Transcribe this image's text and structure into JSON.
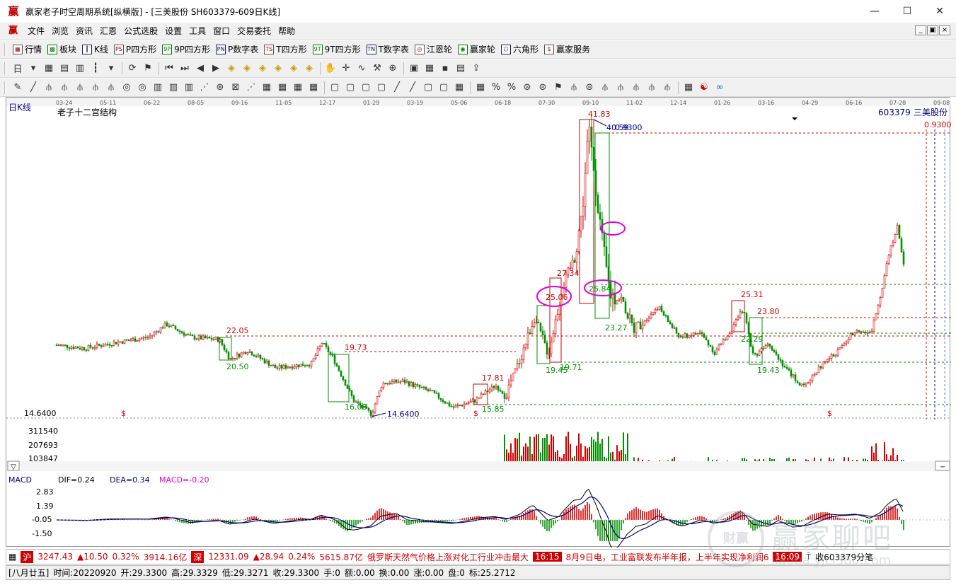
{
  "window": {
    "title": "赢家老子时空周期系统[纵横版] - [三美股份   SH603379-609日K线]",
    "logo_glyph": "赢",
    "controls": {
      "minimize": "—",
      "maximize": "☐",
      "close": "✕"
    }
  },
  "menu": {
    "logo_glyph": "赢",
    "items": [
      "文件",
      "浏览",
      "资讯",
      "汇恩",
      "公式选股",
      "设置",
      "工具",
      "窗口",
      "交易委托",
      "帮助"
    ],
    "mdi": [
      "_",
      "▣",
      "×"
    ]
  },
  "toolbar1": {
    "items": [
      {
        "icon": "market-icon",
        "glyph": "▦",
        "label": "行情"
      },
      {
        "icon": "sector-icon",
        "glyph": "▩",
        "label": "板块"
      },
      {
        "icon": "kline-icon",
        "glyph": "┃",
        "label": "K线"
      },
      {
        "icon": "ps-icon",
        "glyph": "PS",
        "label": "P四方形"
      },
      {
        "icon": "9p-icon",
        "glyph": "9P",
        "label": "9P四方形"
      },
      {
        "icon": "pn-icon",
        "glyph": "PN",
        "label": "P数字表"
      },
      {
        "icon": "ts-icon",
        "glyph": "TS",
        "label": "T四方形"
      },
      {
        "icon": "9t-icon",
        "glyph": "9T",
        "label": "9T四方形"
      },
      {
        "icon": "tn-icon",
        "glyph": "TN",
        "label": "T数字表"
      },
      {
        "icon": "jiangen-wheel-icon",
        "glyph": "◎",
        "label": "江恩轮"
      },
      {
        "icon": "winner-wheel-icon",
        "glyph": "◉",
        "label": "赢家轮"
      },
      {
        "icon": "hexagon-icon",
        "glyph": "⬡",
        "label": "六角形"
      },
      {
        "icon": "dollar-icon",
        "glyph": "$",
        "label": "赢家服务"
      }
    ]
  },
  "toolbar2": {
    "icons": [
      "period-icon",
      "dropdown-icon",
      "grid-icon",
      "chart-icon",
      "bars-icon",
      "candle-icon",
      "dropdown-icon",
      "sep",
      "refresh-icon",
      "flag-icon",
      "sep",
      "first-icon",
      "last-icon",
      "prev-icon",
      "next-icon",
      "diamond-icon",
      "diamond-icon",
      "diamond-icon",
      "diamond-icon",
      "diamond-icon",
      "diamond-icon",
      "sep",
      "hand-icon",
      "crosshair-icon",
      "wave-icon",
      "tool-icon",
      "zoom-icon",
      "sep",
      "calendar-icon",
      "calc-icon",
      "save-icon",
      "print-icon",
      "export-icon"
    ]
  },
  "toolbar3": {
    "icons": [
      "pen-icon",
      "line-icon",
      "fork-icon",
      "fork-icon",
      "fork-icon",
      "fork-icon",
      "fork-icon",
      "circle-icon",
      "circle-icon",
      "bars-icon",
      "bars-icon",
      "bars-icon",
      "fan-icon",
      "target-icon",
      "cross-icon",
      "fan-icon",
      "grid-icon",
      "grid-icon",
      "grid-icon",
      "grid-icon",
      "sep",
      "box-icon",
      "box-icon",
      "box-icon",
      "box-icon",
      "line-icon",
      "line-icon",
      "box-icon",
      "box-icon",
      "grid-icon",
      "sep",
      "table-icon",
      "percent-icon",
      "percent-icon",
      "coin-icon",
      "coin-icon",
      "flag-icon",
      "fork-icon",
      "coin-icon",
      "fork-icon",
      "fork-icon",
      "fork-icon",
      "fork-icon",
      "fork-icon",
      "sep",
      "table-icon",
      "yinyang-icon",
      "infinity-icon"
    ]
  },
  "chart": {
    "period_label": "日K线",
    "indicator_name": "老子十二宫结构",
    "stock_code": "603379",
    "stock_name": "三美股份",
    "top_right_overlay": "0.9300",
    "low_axis_label": "14.6400",
    "date_ticks": [
      "03-24",
      "05-11",
      "06-22",
      "08-05",
      "09-16",
      "11-05",
      "12-17",
      "01-29",
      "03-19",
      "05-06",
      "06-18",
      "07-30",
      "09-10",
      "11-02",
      "12-14",
      "01-26",
      "03-16",
      "04-29",
      "06-16",
      "07-28",
      "09-08"
    ],
    "price_labels": [
      {
        "text": "41.83",
        "color": "#d00000"
      },
      {
        "text": "40.59",
        "color": "#000080"
      },
      {
        "text": "0.9300",
        "color": "#000080"
      },
      {
        "text": "27.34",
        "color": "#d00000"
      },
      {
        "text": "25.84",
        "color": "#009000"
      },
      {
        "text": "25.06",
        "color": "#d00000"
      },
      {
        "text": "23.27",
        "color": "#009000"
      },
      {
        "text": "22.05",
        "color": "#d00000"
      },
      {
        "text": "20.50",
        "color": "#d00000"
      },
      {
        "text": "19.73",
        "color": "#009000"
      },
      {
        "text": "16.08",
        "color": "#009000"
      },
      {
        "text": "14.6400",
        "color": "#000080"
      },
      {
        "text": "17.81",
        "color": "#d00000"
      },
      {
        "text": "15.85",
        "color": "#009000"
      },
      {
        "text": "19.45",
        "color": "#009000"
      },
      {
        "text": "19.71",
        "color": "#009000"
      },
      {
        "text": "25.31",
        "color": "#d00000"
      },
      {
        "text": "23.80",
        "color": "#d00000"
      },
      {
        "text": "22.29",
        "color": "#009000"
      },
      {
        "text": "19.43",
        "color": "#009000"
      }
    ],
    "dollar_marker": "$",
    "volume_ticks": [
      "311540",
      "207693",
      "103847"
    ],
    "scroll_down": "▽",
    "scroll_dash": "−"
  },
  "macd": {
    "title": "MACD",
    "dif_label": "DIF=0.24",
    "dea_label": "DEA=0.34",
    "macd_label": "MACD=-0.20",
    "ticks": [
      "2.83",
      "1.39",
      "-0.05",
      "-1.50"
    ]
  },
  "status1": {
    "sh_icon": "沪",
    "sh_index": "3247.43",
    "sh_change": "▲10.50",
    "sh_pct": "0.32%",
    "sh_amount": "3914.16亿",
    "sz_icon": "深",
    "sz_index": "12331.09",
    "sz_change": "▲28.94",
    "sz_pct": "0.24%",
    "sz_amount": "5615.87亿",
    "news1": "俄罗斯天然气价格上涨对化工行业冲击最大",
    "time1": "16:15",
    "news2": "8月9日电，工业富联发布半年报，上半年实现净利润6",
    "time2": "16:09",
    "close_label": "收603379分笔"
  },
  "status2": {
    "lunar": "[八月廿五]",
    "time": "时间:20220920",
    "open": "开:29.3300",
    "high": "高:29.3329",
    "low": "低:29.3271",
    "close": "收:29.3300",
    "hands": "手:0",
    "amount": "额:0.00",
    "turnover": "换:0.00",
    "change": "涨:0.00",
    "disk": "盘:0",
    "mark": "标:25.2712"
  },
  "watermark": {
    "logo": "财赢",
    "text": "赢家聊吧",
    "url": "liaoba.yjcl360.com"
  }
}
